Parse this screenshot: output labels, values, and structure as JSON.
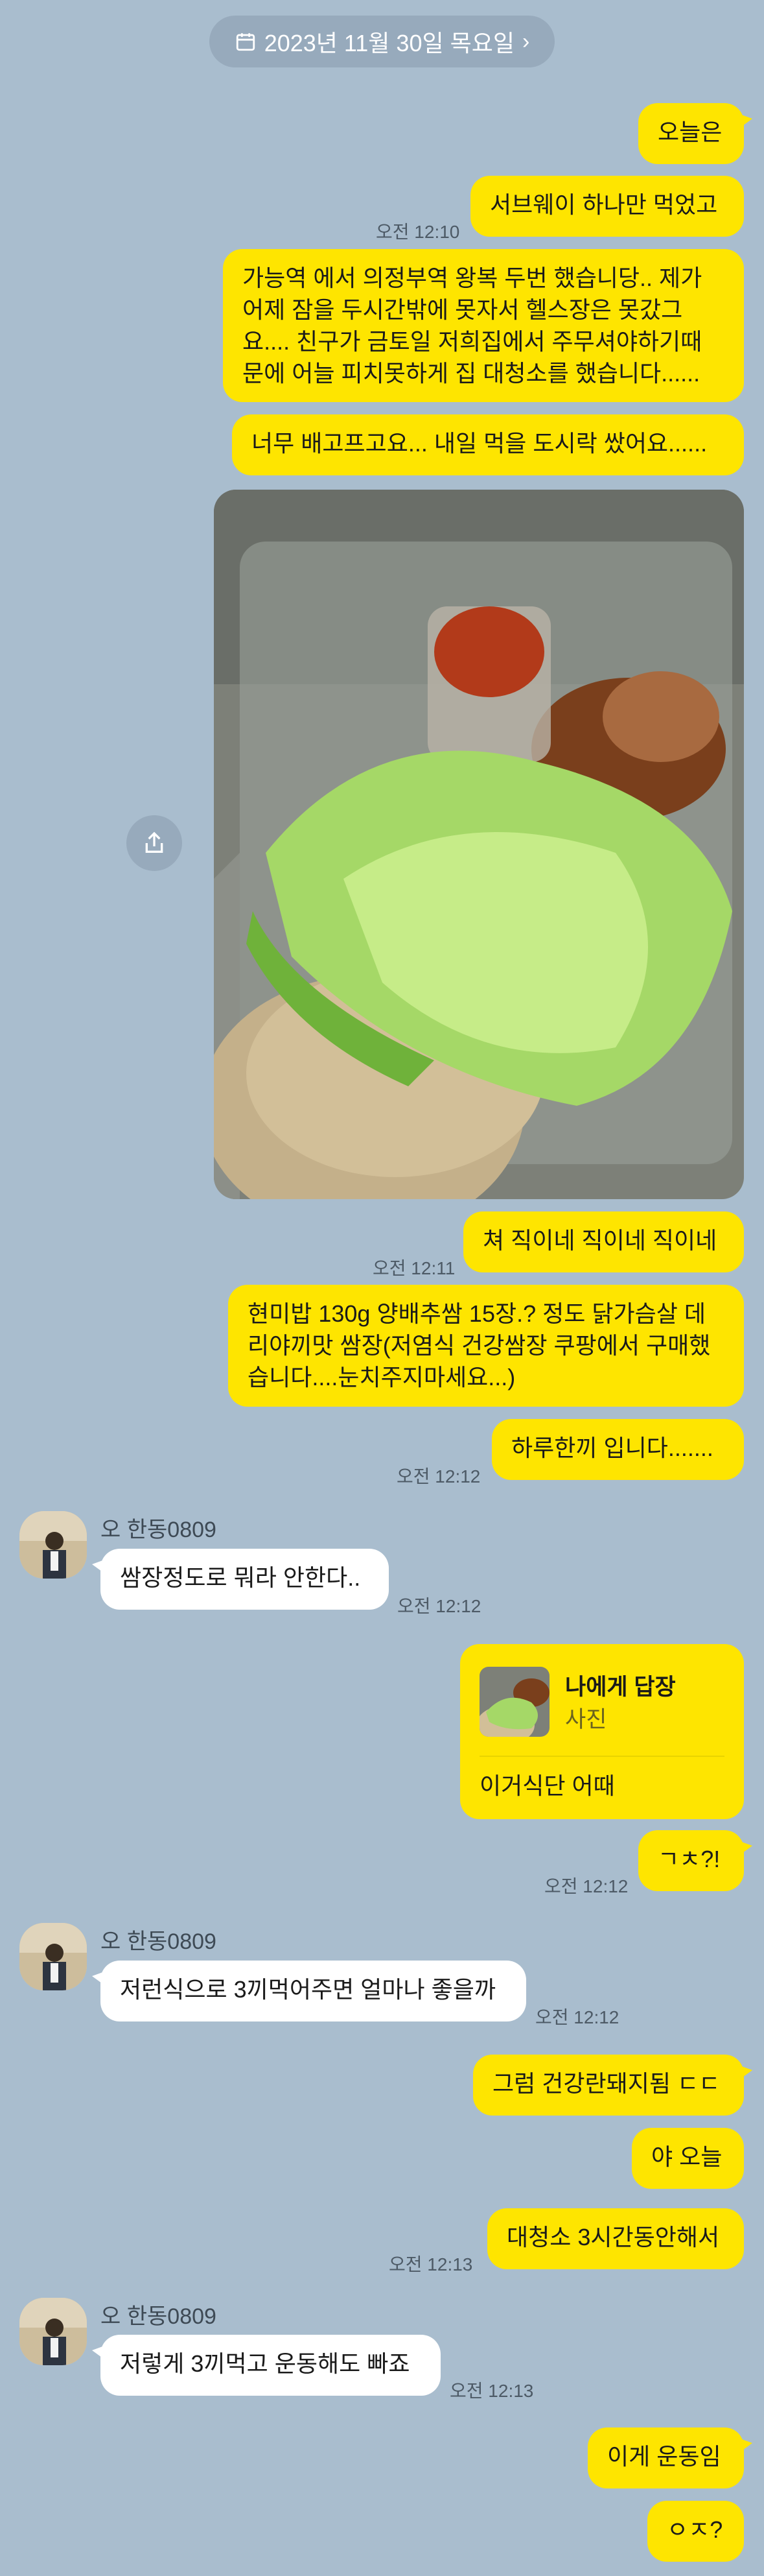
{
  "date_divider": "2023년 11월 30일 목요일",
  "colors": {
    "background": "#a9bdce",
    "my_bubble": "#fee500",
    "their_bubble": "#ffffff",
    "date_pill": "#97aabc"
  },
  "sender": "오 한동0809",
  "messages": [
    {
      "from": "me",
      "text": "오늘은"
    },
    {
      "from": "me",
      "text": "서브웨이 하나만 먹었고",
      "time": "오전 12:10"
    },
    {
      "from": "me",
      "text": "가능역 에서 의정부역 왕복 두번 했습니당.. 제가\n어제 잠을 두시간밖에 못자서 헬스장은 못갔그\n요.... 친구가 금토일 저희집에서 주무셔야하기때\n문에 어늘 피치못하게 집 대청소를 했습니다......"
    },
    {
      "from": "me",
      "text": "너무 배고프고요... 내일 먹을 도시락 쌌어요......"
    },
    {
      "from": "me",
      "text": "쳐 직이네 직이네 직이네",
      "time": "오전 12:11"
    },
    {
      "from": "me",
      "text": "현미밥 130g 양배추쌈 15장.? 정도 닭가슴살 데\n리야끼맛 쌈장(저염식 건강쌈장 쿠팡에서 구매했\n습니다....눈치주지마세요...)"
    },
    {
      "from": "me",
      "text": "하루한끼 입니다.......",
      "time": "오전 12:12"
    },
    {
      "from": "them",
      "text": "쌈장정도로 뭐라 안한다..",
      "time": "오전 12:12"
    },
    {
      "from": "me",
      "text": "ㄱㅊ?!",
      "time": "오전 12:12"
    },
    {
      "from": "them",
      "text": "저런식으로 3끼먹어주면 얼마나 좋을까",
      "time": "오전 12:12"
    },
    {
      "from": "me",
      "text": "그럼 건강란돼지됨 ㄷㄷ"
    },
    {
      "from": "me",
      "text": "야 오늘"
    },
    {
      "from": "me",
      "text": "대청소 3시간동안해서",
      "time": "오전 12:13"
    },
    {
      "from": "them",
      "text": "저렇게 3끼먹고 운동해도 빠죠",
      "time": "오전 12:13"
    },
    {
      "from": "me",
      "text": "이게 운동임"
    },
    {
      "from": "me",
      "text": "ㅇㅈ?"
    }
  ],
  "reply": {
    "title": "나에게 답장",
    "subtitle": "사진",
    "text": "이거식단 어때"
  }
}
